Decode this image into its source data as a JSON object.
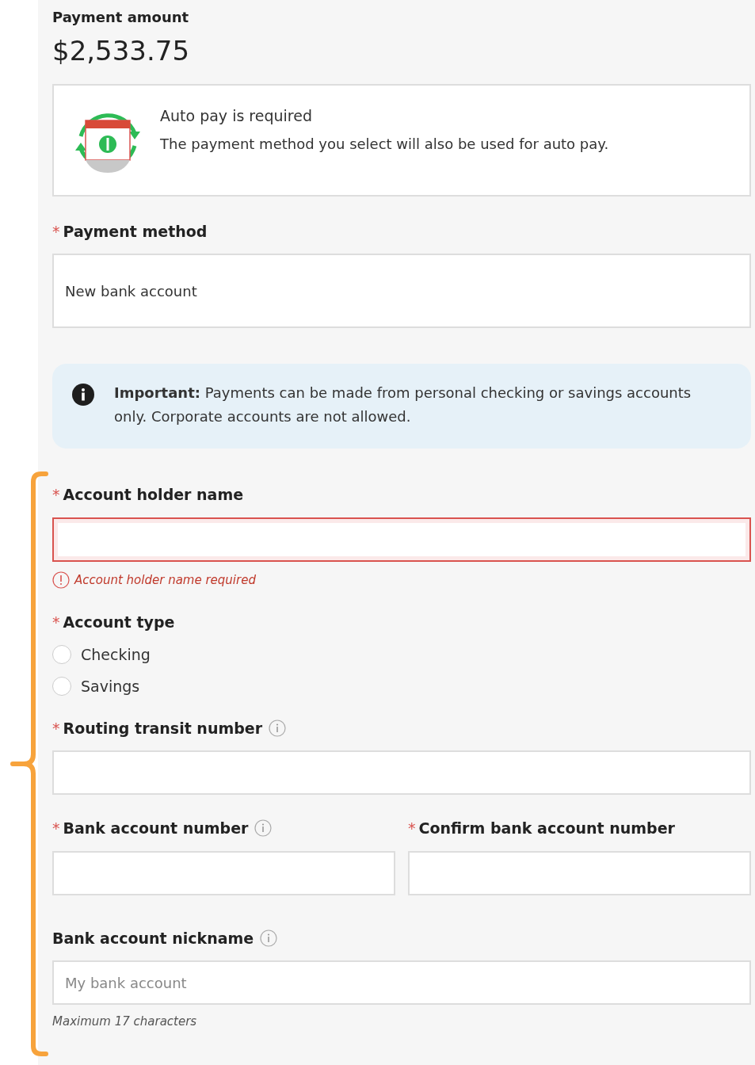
{
  "payment_amount": {
    "label": "Payment amount",
    "value": "$2,533.75"
  },
  "autopay_notice": {
    "title": "Auto pay is required",
    "text": "The payment method you select will also be used for auto pay."
  },
  "payment_method": {
    "label": "Payment method",
    "marker": "*",
    "info": false,
    "value": "New bank account"
  },
  "info_banner": {
    "text": "**Important:** Payments can be made from personal checking or savings accounts only. Corporate accounts are not allowed."
  },
  "fields": [
    {
      "kind": "text",
      "label": "Account holder name",
      "marker": "*",
      "info": false,
      "error": "Account holder name required"
    },
    {
      "kind": "radio",
      "label": "Account type",
      "marker": "*",
      "info": false,
      "options": [
        {
          "label": "Checking",
          "selected": false
        },
        {
          "label": "Savings",
          "selected": false
        }
      ]
    },
    {
      "kind": "text",
      "label": "Routing transit number",
      "marker": "*",
      "info": true
    },
    {
      "kind": "pair",
      "items": [
        {
          "label": "Bank account number",
          "marker": "*",
          "info": true
        },
        {
          "label": "Confirm bank account number",
          "marker": "*",
          "info": false
        }
      ]
    },
    {
      "kind": "text",
      "label": "Bank account nickname",
      "info": true,
      "placeholder": "My bank account",
      "hint": "Maximum 17 characters"
    }
  ]
}
